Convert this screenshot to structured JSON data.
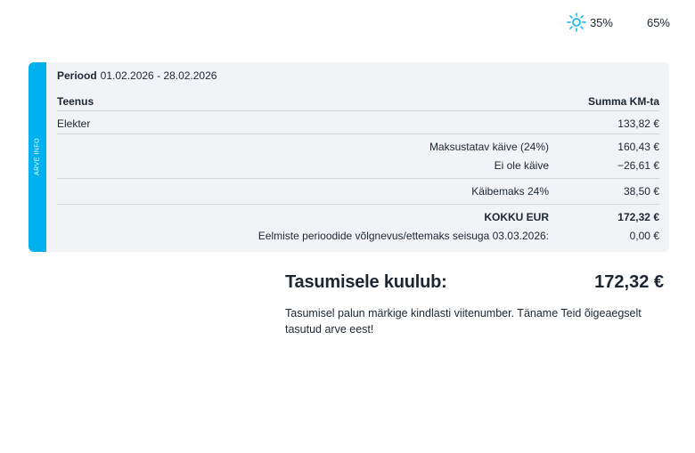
{
  "usage": {
    "day": {
      "icon": "sun-icon",
      "percent": "35%",
      "color": "#00b1f0"
    },
    "night": {
      "icon": "moon-icon",
      "percent": "65%",
      "color": "#00b1f0"
    }
  },
  "invoice": {
    "strip_label": "ARVE INFO",
    "accent_color": "#00b1f0",
    "period_label": "Periood",
    "period_value": "01.02.2026 - 28.02.2026",
    "header_service": "Teenus",
    "header_amount": "Summa KM-ta",
    "service_name": "Elekter",
    "service_amount": "133,82 €",
    "taxable_label": "Maksustatav käive (24%)",
    "taxable_amount": "160,43 €",
    "nontaxable_label": "Ei ole käive",
    "nontaxable_amount": "−26,61 €",
    "vat_label": "Käibemaks 24%",
    "vat_amount": "38,50 €",
    "total_label": "KOKKU EUR",
    "total_amount": "172,32 €",
    "previous_label": "Eelmiste perioodide võlgnevus/ettemaks seisuga 03.03.2026:",
    "previous_amount": "0,00 €"
  },
  "payment": {
    "title": "Tasumisele kuulub:",
    "amount": "172,32 €",
    "note": "Tasumisel palun märkige kindlasti viitenumber. Täname Teid õigeaegselt tasutud arve eest!"
  }
}
